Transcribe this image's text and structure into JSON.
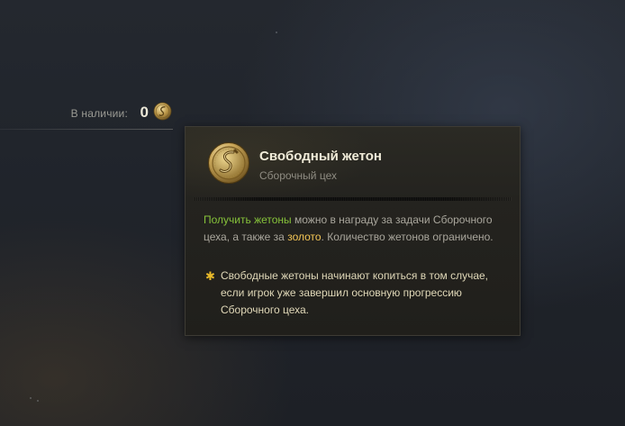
{
  "availability": {
    "label": "В наличии:",
    "count": "0",
    "icon": "token-coin-icon"
  },
  "tooltip": {
    "icon": "free-token-coin-icon",
    "title": "Свободный жетон",
    "subtitle": "Сборочный цех",
    "body": {
      "part1": "Получить жетоны",
      "part2": " можно в награду за задачи Сборочного цеха, а также за ",
      "part3": "золото",
      "part4": ". Количество жетонов ограничено."
    },
    "note": {
      "bullet": "✱",
      "text": "Свободные жетоны начинают копиться в том случае, если игрок уже завершил основную прогрессию Сборочного цеха."
    }
  },
  "colors": {
    "green_highlight": "#86c23a",
    "gold_highlight": "#f3c555",
    "note_bullet": "#e8b92a"
  }
}
